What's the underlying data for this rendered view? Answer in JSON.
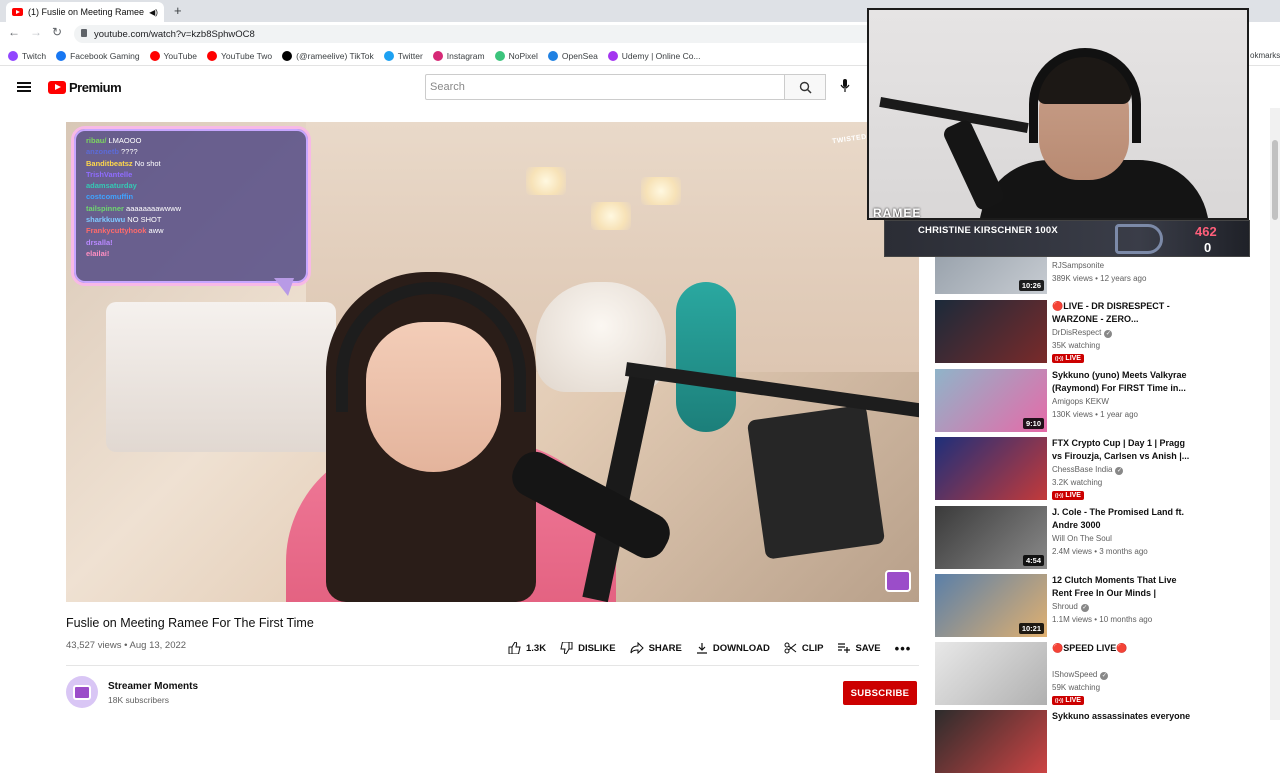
{
  "browser": {
    "tab_title": "(1) Fuslie on Meeting Ramee",
    "url": "youtube.com/watch?v=kzb8SphwOC8",
    "bookmarks": [
      {
        "label": "Twitch",
        "color": "#9146ff"
      },
      {
        "label": "Facebook Gaming",
        "color": "#1877f2"
      },
      {
        "label": "YouTube",
        "color": "#ff0000"
      },
      {
        "label": "YouTube Two",
        "color": "#ff0000"
      },
      {
        "label": "(@rameelive) TikTok",
        "color": "#000000"
      },
      {
        "label": "Twitter",
        "color": "#1da1f2"
      },
      {
        "label": "Instagram",
        "color": "#d62976"
      },
      {
        "label": "NoPixel",
        "color": "#3cc47c"
      },
      {
        "label": "OpenSea",
        "color": "#2081e2"
      },
      {
        "label": "Udemy | Online Co...",
        "color": "#a435f0"
      }
    ],
    "bookmarks_overflow": "okmarks"
  },
  "youtube": {
    "logo_text": "Premium",
    "search_placeholder": "Search"
  },
  "stream_chat": [
    {
      "user": "ribau/",
      "msg": "LMAOOO",
      "color": "#7cd65f"
    },
    {
      "user": "anzonetb",
      "msg": "????",
      "color": "#5c6bd6"
    },
    {
      "user": "Banditbeatsz",
      "msg": "No shot",
      "color": "#ffd84a"
    },
    {
      "user": "",
      "msg": "",
      "color": "#e04848"
    },
    {
      "user": "TrishVantelle",
      "msg": "",
      "color": "#8f6cff"
    },
    {
      "user": "adamsaturday",
      "msg": "",
      "color": "#35c8b4"
    },
    {
      "user": "costcomuffin",
      "msg": "",
      "color": "#3fa3ff"
    },
    {
      "user": "tailspinner",
      "msg": "aaaaaaaawwww",
      "color": "#6ed66e"
    },
    {
      "user": "sharkkuwu",
      "msg": "NO SHOT",
      "color": "#7fc8ff"
    },
    {
      "user": "Frankycuttyhook",
      "msg": "aww",
      "color": "#ff6b6b"
    },
    {
      "user": "drsalla!",
      "msg": "",
      "color": "#b989ff"
    },
    {
      "user": "elailai!",
      "msg": "",
      "color": "#ff8fc2"
    }
  ],
  "video": {
    "overlay_brand": "TWISTED",
    "title": "Fuslie on Meeting Ramee For The First Time",
    "meta": "43,527 views • Aug 13, 2022",
    "actions": {
      "like": "1.3K",
      "dislike": "DISLIKE",
      "share": "SHARE",
      "download": "DOWNLOAD",
      "clip": "CLIP",
      "save": "SAVE"
    },
    "channel_name": "Streamer Moments",
    "channel_subs": "18K subscribers",
    "subscribe_label": "SUBSCRIBE"
  },
  "webcam": {
    "brand": "RAMEE",
    "donation_name": "CHRISTINE KIRSCHNER 100X",
    "stat_top": "462",
    "stat_bottom": "0"
  },
  "recommendations": [
    {
      "title": "",
      "channel": "RJSampsonite",
      "meta": "389K views • 12 years ago",
      "duration": "10:26",
      "live": false,
      "verified": false,
      "thumb": [
        "#9aa3ad",
        "#c7ccd2"
      ]
    },
    {
      "title": "🔴LIVE - DR DISRESPECT - WARZONE - ZERO...",
      "channel": "DrDisRespect",
      "meta": "35K watching",
      "duration": "",
      "live": true,
      "verified": true,
      "thumb": [
        "#1b2a3a",
        "#7a2a2a"
      ]
    },
    {
      "title": "Sykkuno (yuno) Meets Valkyrae (Raymond) For FIRST Time in...",
      "channel": "Amigops KEKW",
      "meta": "130K views • 1 year ago",
      "duration": "9:10",
      "live": false,
      "verified": false,
      "thumb": [
        "#8fb4c9",
        "#e66aa8"
      ]
    },
    {
      "title": "FTX Crypto Cup | Day 1 | Pragg vs Firouzja, Carlsen vs Anish |...",
      "channel": "ChessBase India",
      "meta": "3.2K watching",
      "duration": "",
      "live": true,
      "verified": true,
      "thumb": [
        "#1e2f7a",
        "#c33a3a"
      ]
    },
    {
      "title": "J. Cole - The Promised Land ft. Andre 3000",
      "channel": "Will On The Soul",
      "meta": "2.4M views • 3 months ago",
      "duration": "4:54",
      "live": false,
      "verified": false,
      "thumb": [
        "#3a3a3a",
        "#8a8a8a"
      ]
    },
    {
      "title": "12 Clutch Moments That Live Rent Free In Our Minds | Shrou...",
      "channel": "Shroud",
      "meta": "1.1M views • 10 months ago",
      "duration": "10:21",
      "live": false,
      "verified": true,
      "thumb": [
        "#5a7fa8",
        "#e0b070"
      ]
    },
    {
      "title": "🔴SPEED LIVE🔴",
      "channel": "IShowSpeed",
      "meta": "59K watching",
      "duration": "",
      "live": true,
      "verified": true,
      "thumb": [
        "#e8e8e8",
        "#b0b0b0"
      ]
    },
    {
      "title": "Sykkuno assassinates everyone",
      "channel": "",
      "meta": "",
      "duration": "",
      "live": false,
      "verified": false,
      "thumb": [
        "#2c2c2c",
        "#c44"
      ]
    }
  ],
  "live_label": "LIVE"
}
